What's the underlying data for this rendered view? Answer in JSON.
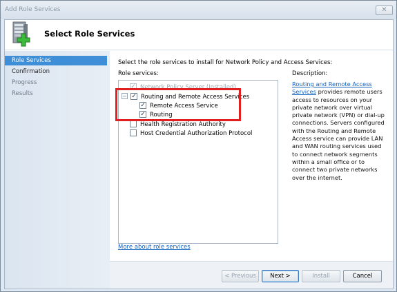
{
  "window": {
    "title": "Add Role Services",
    "close_glyph": "✕"
  },
  "header": {
    "title": "Select Role Services",
    "icon": "server-add-icon"
  },
  "nav": {
    "items": [
      {
        "label": "Role Services",
        "selected": true
      },
      {
        "label": "Confirmation"
      },
      {
        "label": "Progress"
      },
      {
        "label": "Results"
      }
    ]
  },
  "main": {
    "instruction": "Select the role services to install for Network Policy and Access Services:",
    "role_services_label": "Role services:",
    "tree": [
      {
        "label": "Network Policy Server  (Installed)",
        "checked": true,
        "disabled": true
      },
      {
        "label": "Routing and Remote Access Services",
        "checked": true,
        "expander": "−"
      },
      {
        "label": "Remote Access Service",
        "checked": true
      },
      {
        "label": "Routing",
        "checked": true
      },
      {
        "label": "Health Registration Authority",
        "checked": false
      },
      {
        "label": "Host Credential Authorization Protocol",
        "checked": false
      }
    ],
    "checkmark": "✓",
    "more_link": "More about role services",
    "description_label": "Description:",
    "description_link": "Routing and Remote Access Services",
    "description_text": " provides remote users access to resources on your private network over virtual private network (VPN) or dial-up connections. Servers configured with the Routing and Remote Access service can provide LAN and WAN routing services used to connect network segments within a small office or to connect two private networks over the internet."
  },
  "footer": {
    "previous": "< Previous",
    "next": "Next >",
    "install": "Install",
    "cancel": "Cancel"
  },
  "colors": {
    "highlight": "#e02020",
    "nav_selected": "#3f8fd8",
    "link": "#1060c0"
  }
}
